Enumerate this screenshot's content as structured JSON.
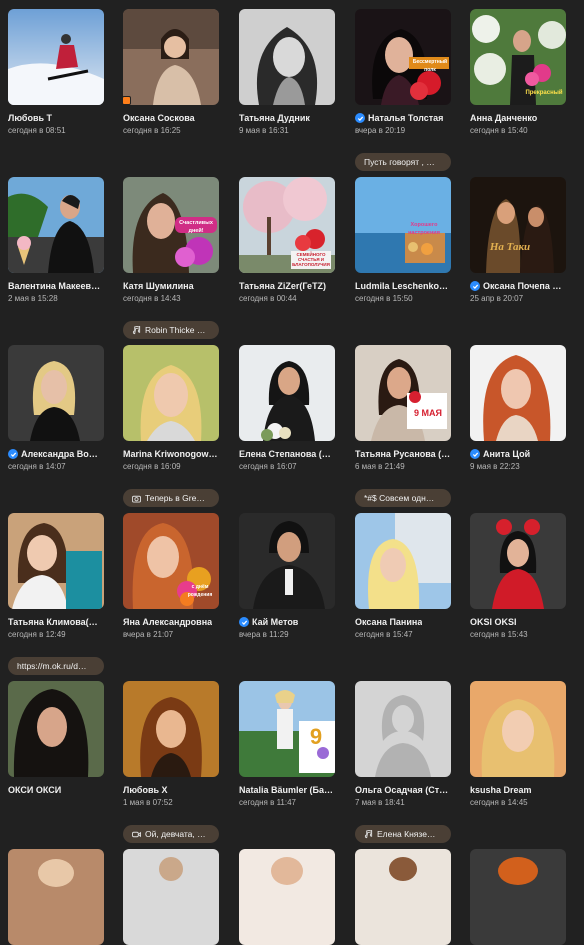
{
  "colors": {
    "background": "#212121",
    "pill": "#4a3f35",
    "verified": "#2b8cff",
    "online": "#ff7f1a"
  },
  "rows": [
    [
      {
        "name": "Любовь Т",
        "time": "сегодня в 08:51"
      },
      {
        "name": "Оксана Соскова",
        "time": "сегодня в 16:25",
        "online": true
      },
      {
        "name": "Татьяна Дудник",
        "time": "9 мая в 16:31"
      },
      {
        "name": "Наталья Толстая",
        "time": "вчера в 20:19",
        "verified": true,
        "sticker": "Бессмертный полк"
      },
      {
        "name": "Анна Данченко",
        "time": "сегодня в 15:40",
        "sticker": "Прекрасный"
      }
    ],
    [
      {
        "name": "Валентина Макеев…",
        "time": "2 мая в 15:28"
      },
      {
        "name": "Катя Шумилина",
        "time": "сегодня в 14:43",
        "sticker": "Счастливых дней!"
      },
      {
        "name": "Татьяна ZiZer(ГеТZ)",
        "time": "сегодня в 00:44",
        "sticker": "СЕМЕЙНОГО СЧАСТЬЯ И БЛАГОПОЛУЧИЯ"
      },
      {
        "name": "Ludmila Leschenko…",
        "time": "сегодня в 15:50",
        "sticker": "Хорошего настроения"
      },
      {
        "name": "Оксана Почепа …",
        "time": "25 апр в 20:07",
        "verified": true,
        "sticker": "На Таки"
      }
    ],
    [
      {
        "name": "Александра Во…",
        "time": "сегодня в 14:07",
        "verified": true
      },
      {
        "name": "Marina Kriwonogow…",
        "time": "сегодня в 16:09"
      },
      {
        "name": "Елена Степанова (…",
        "time": "сегодня в 16:07"
      },
      {
        "name": "Татьяна Русанова (…",
        "time": "6 мая в 21:49",
        "sticker": "9 МАЯ"
      },
      {
        "name": "Анита Цой",
        "time": "9 мая в 22:23",
        "verified": true
      }
    ],
    [
      {
        "name": "Татьяна Климова(…",
        "time": "сегодня в 12:49"
      },
      {
        "name": "Яна Александровна",
        "time": "вчера в 21:07",
        "sticker": "с днём рождения"
      },
      {
        "name": "Кай Метов",
        "time": "вчера в 11:29",
        "verified": true
      },
      {
        "name": "Оксана Панина",
        "time": "сегодня в 15:47"
      },
      {
        "name": "OKSI OKSI",
        "time": "сегодня в 15:43"
      }
    ],
    [
      {
        "name": "ОКСИ ОКСИ",
        "time": ""
      },
      {
        "name": "Любовь Х",
        "time": "1 мая в 07:52"
      },
      {
        "name": "Natalia Bäumler (Ба…",
        "time": "сегодня в 11:47",
        "sticker": "9"
      },
      {
        "name": "Ольга Осадчая (Ст…",
        "time": "7 мая в 18:41"
      },
      {
        "name": "ksusha Dream",
        "time": "сегодня в 14:45"
      }
    ]
  ],
  "status_pills": [
    {
      "text": "Пусть говорят , …",
      "icon": "none"
    },
    {
      "text": "Robin Thicke …",
      "icon": "music-note-icon"
    },
    {
      "text": "Теперь в Gre…",
      "icon": "camera-icon"
    },
    {
      "text": "*#$ Совсем одн…",
      "icon": "none"
    },
    {
      "text": "https://m.ok.ru/d…",
      "icon": "none"
    },
    {
      "text": "Ой, девчата, …",
      "icon": "video-icon"
    },
    {
      "text": "Елена Князе…",
      "icon": "music-note-icon"
    }
  ]
}
